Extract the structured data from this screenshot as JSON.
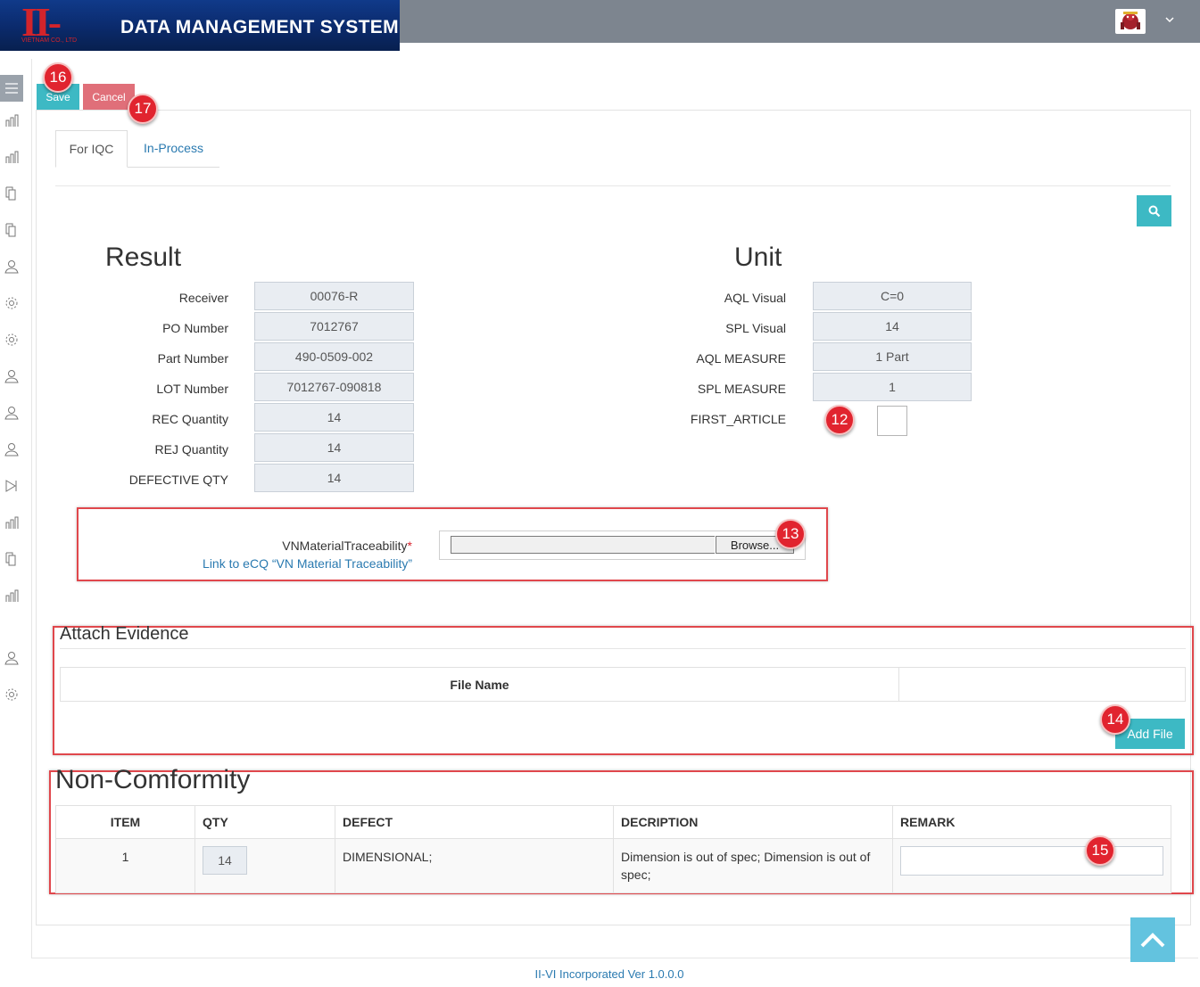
{
  "header": {
    "logo_text": "II-VI",
    "logo_subtext": "VIETNAM CO., LTD",
    "app_title": "DATA MANAGEMENT SYSTEM"
  },
  "toolbar": {
    "save_label": "Save",
    "cancel_label": "Cancel"
  },
  "tabs": [
    {
      "label": "For IQC",
      "active": true
    },
    {
      "label": "In-Process",
      "active": false
    }
  ],
  "result": {
    "heading": "Result",
    "fields": [
      {
        "label": "Receiver",
        "value": "00076-R"
      },
      {
        "label": "PO Number",
        "value": "7012767"
      },
      {
        "label": "Part Number",
        "value": "490-0509-002"
      },
      {
        "label": "LOT Number",
        "value": "7012767-090818"
      },
      {
        "label": "REC Quantity",
        "value": "14"
      },
      {
        "label": "REJ Quantity",
        "value": "14"
      },
      {
        "label": "DEFECTIVE QTY",
        "value": "14"
      }
    ]
  },
  "unit": {
    "heading": "Unit",
    "fields": [
      {
        "label": "AQL Visual",
        "value": "C=0"
      },
      {
        "label": "SPL Visual",
        "value": "14"
      },
      {
        "label": "AQL MEASURE",
        "value": "1 Part"
      },
      {
        "label": "SPL MEASURE",
        "value": "1"
      }
    ],
    "first_article_label": "FIRST_ARTICLE",
    "first_article_checked": false
  },
  "traceability": {
    "label": "VNMaterialTraceability",
    "required_mark": "*",
    "link_text": "Link to eCQ “VN Material Traceability”",
    "browse_label": "Browse..."
  },
  "attach": {
    "title": "Attach Evidence",
    "columns": [
      "File Name",
      ""
    ],
    "add_label": "Add File"
  },
  "nonconformity": {
    "title": "Non-Comformity",
    "columns": [
      "ITEM",
      "QTY",
      "DEFECT",
      "DECRIPTION",
      "REMARK"
    ],
    "rows": [
      {
        "item": "1",
        "qty": "14",
        "defect": "DIMENSIONAL;",
        "description": "Dimension is out of spec; Dimension is out of spec;",
        "remark": ""
      }
    ]
  },
  "badges": [
    "16",
    "17",
    "12",
    "13",
    "14",
    "15"
  ],
  "footer": {
    "text": "II-VI Incorporated Ver 1.0.0.0"
  },
  "colors": {
    "topbar": "#7d858f",
    "accent": "#3db9c4",
    "cancel": "#e06f79",
    "link": "#2a7ab0",
    "annotation_red": "#e1242f"
  },
  "sidebar_icons": [
    "menu-icon",
    "bar-chart-icon",
    "bar-chart-icon",
    "documents-icon",
    "documents-icon",
    "user-icon",
    "gear-icon",
    "gear-icon",
    "user-icon",
    "user-icon",
    "user-icon",
    "skip-forward-icon",
    "bar-chart-icon",
    "documents-icon",
    "bar-chart-icon",
    "user-icon",
    "gear-icon"
  ]
}
